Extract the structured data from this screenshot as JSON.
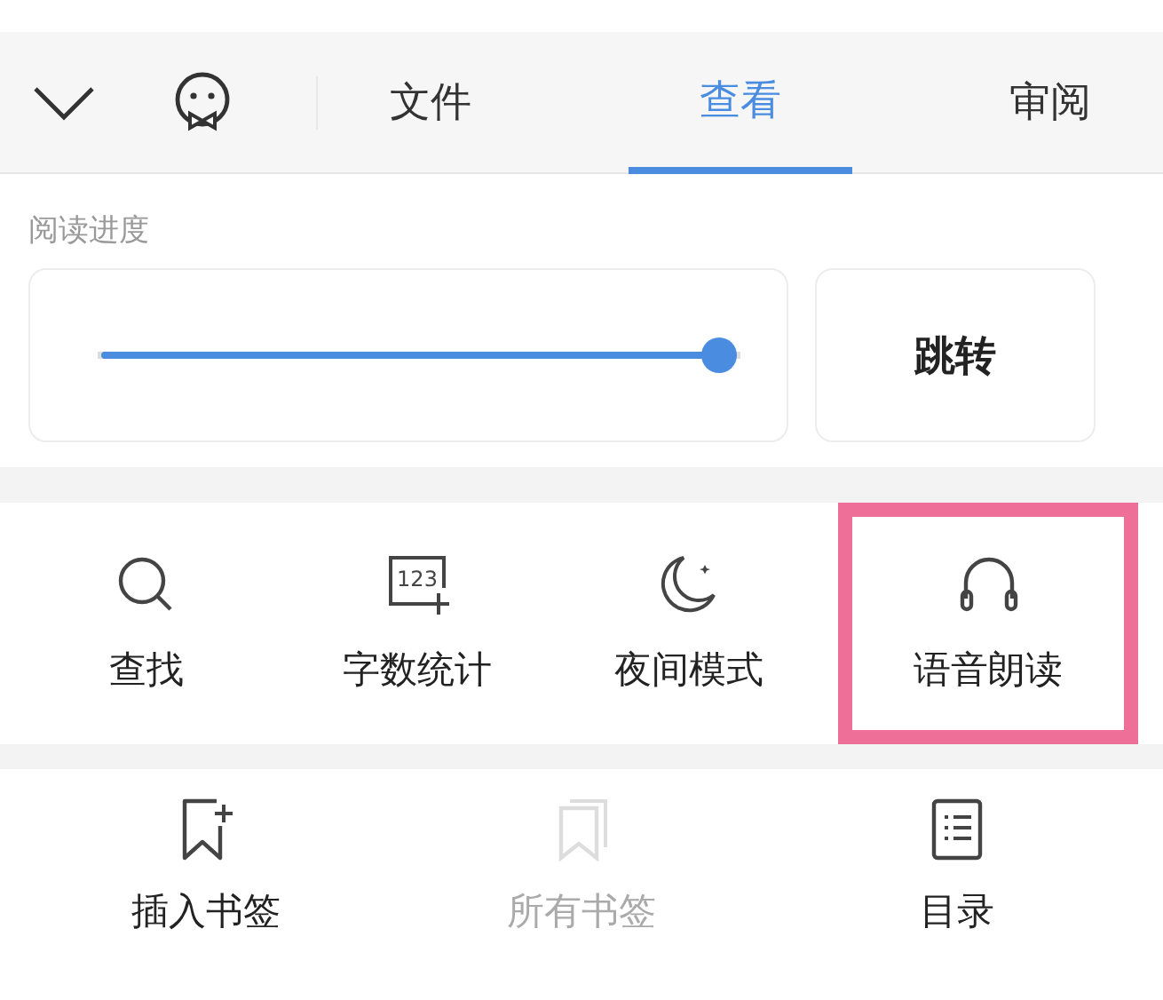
{
  "tabs": [
    {
      "label": "文件",
      "selected": false
    },
    {
      "label": "查看",
      "selected": true
    },
    {
      "label": "审阅",
      "selected": false
    }
  ],
  "progress": {
    "label": "阅读进度",
    "level": 1.0,
    "button": "跳转"
  },
  "tools": [
    {
      "kind": "search",
      "label": "查找",
      "highlighted": false
    },
    {
      "kind": "count",
      "label": "字数统计",
      "icon_text": "123",
      "highlighted": false
    },
    {
      "kind": "night",
      "label": "夜间模式",
      "highlighted": false
    },
    {
      "kind": "audio",
      "label": "语音朗读",
      "highlighted": true
    }
  ],
  "bookmarks": [
    {
      "kind": "add",
      "label": "插入书签",
      "disabled": false
    },
    {
      "kind": "all",
      "label": "所有书签",
      "disabled": true
    },
    {
      "kind": "toc",
      "label": "目录",
      "disabled": false
    }
  ]
}
